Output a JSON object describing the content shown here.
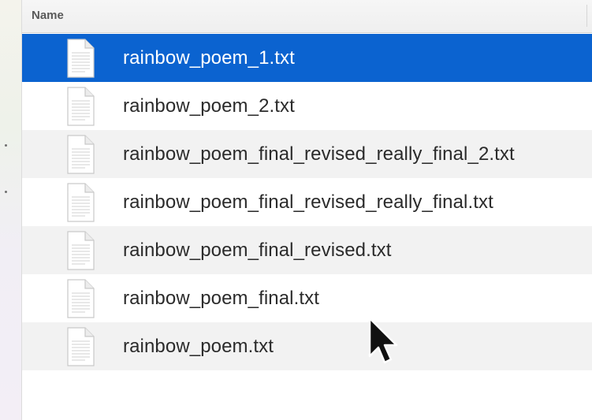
{
  "header": {
    "name_column": "Name"
  },
  "files": [
    {
      "name": "rainbow_poem_1.txt",
      "selected": true,
      "icon": "text-document-icon"
    },
    {
      "name": "rainbow_poem_2.txt",
      "selected": false,
      "icon": "text-document-icon"
    },
    {
      "name": "rainbow_poem_final_revised_really_final_2.txt",
      "selected": false,
      "icon": "text-document-icon"
    },
    {
      "name": "rainbow_poem_final_revised_really_final.txt",
      "selected": false,
      "icon": "text-document-icon"
    },
    {
      "name": "rainbow_poem_final_revised.txt",
      "selected": false,
      "icon": "text-document-icon"
    },
    {
      "name": "rainbow_poem_final.txt",
      "selected": false,
      "icon": "text-document-icon"
    },
    {
      "name": "rainbow_poem.txt",
      "selected": false,
      "icon": "text-document-icon"
    }
  ],
  "colors": {
    "selection": "#0b63d0",
    "row_stripe": "#f2f2f2"
  }
}
